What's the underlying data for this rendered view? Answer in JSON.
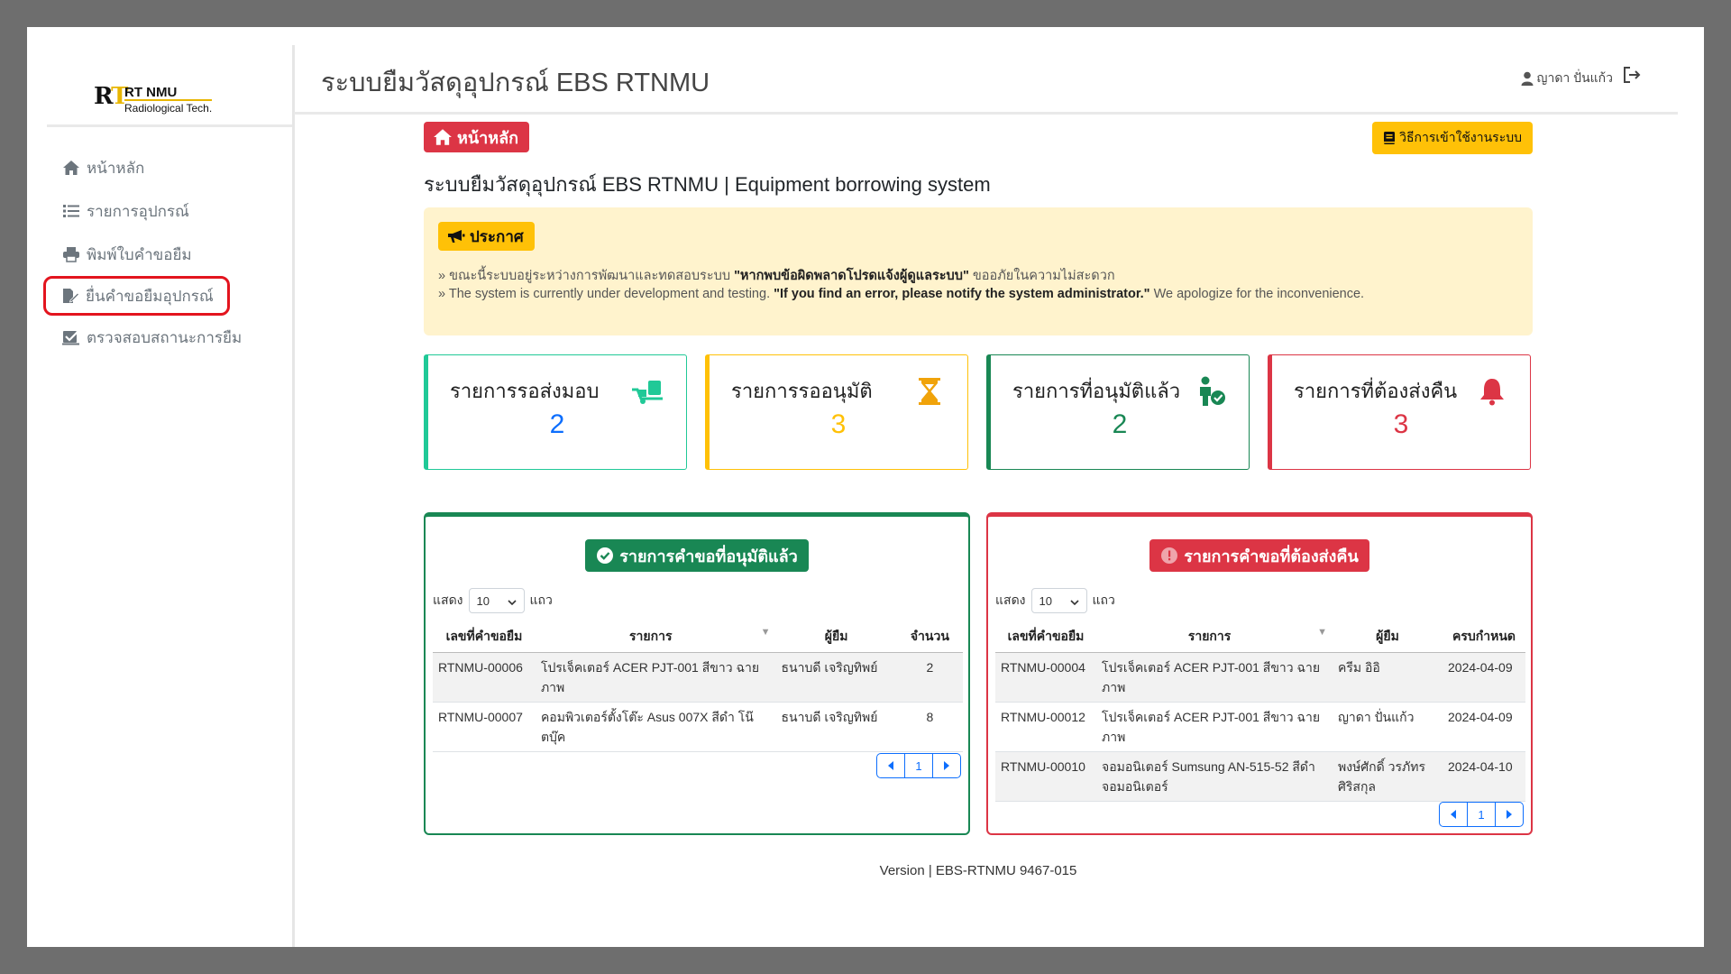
{
  "logo": {
    "mark": "RT",
    "title": "RT NMU",
    "subtitle": "Radiological Tech."
  },
  "sidebar": {
    "items": [
      {
        "label": "หน้าหลัก",
        "icon": "home-icon"
      },
      {
        "label": "รายการอุปกรณ์",
        "icon": "list-icon"
      },
      {
        "label": "พิมพ์ใบคำขอยืม",
        "icon": "printer-icon"
      },
      {
        "label": "ยื่นคำขอยืมอุปกรณ์",
        "icon": "file-edit-icon",
        "highlighted": true
      },
      {
        "label": "ตรวจสอบสถานะการยืม",
        "icon": "check-square-icon"
      }
    ]
  },
  "header": {
    "title": "ระบบยืมวัสดุอุปกรณ์ EBS RTNMU",
    "user_name": "ญาดา ปั่นแก้ว"
  },
  "main": {
    "badge": "หน้าหลัก",
    "guide_button": "วิธีการเข้าใช้งานระบบ",
    "subtitle": "ระบบยืมวัสดุอุปกรณ์ EBS RTNMU | Equipment borrowing system",
    "announcement": {
      "badge": "ประกาศ",
      "th_prefix": "ขณะนี้ระบบอยู่ระหว่างการพัฒนาและทดสอบระบบ ",
      "th_bold": "\"หากพบข้อผิดพลาดโปรดแจ้งผู้ดูแลระบบ\"",
      "th_suffix": " ขออภัยในความไม่สะดวก",
      "en_prefix": "The system is currently under development and testing. ",
      "en_bold": "\"If you find an error, please notify the system administrator.\"",
      "en_suffix": " We apologize for the inconvenience."
    },
    "stats": [
      {
        "label": "รายการรอส่งมอบ",
        "value": "2",
        "color": "#20c997",
        "num_color": "#0d6efd",
        "icon": "dolly-icon"
      },
      {
        "label": "รายการรออนุมัติ",
        "value": "3",
        "color": "#ffc107",
        "num_color": "#ffc107",
        "icon": "hourglass-icon"
      },
      {
        "label": "รายการที่อนุมัติแล้ว",
        "value": "2",
        "color": "#198754",
        "num_color": "#198754",
        "icon": "person-check-icon"
      },
      {
        "label": "รายการที่ต้องส่งคืน",
        "value": "3",
        "color": "#dc3545",
        "num_color": "#dc3545",
        "icon": "bell-icon"
      }
    ],
    "approved": {
      "title": "รายการคำขอที่อนุมัติแล้ว",
      "show_label": "แสดง",
      "page_size": "10",
      "rows_label": "แถว",
      "headers": [
        "เลขที่คำขอยืม",
        "รายการ",
        "ผู้ยืม",
        "จำนวน"
      ],
      "rows": [
        [
          "RTNMU-00006",
          "โปรเจ็คเตอร์ ACER PJT-001 สีขาว ฉายภาพ",
          "ธนาบดี เจริญทิพย์",
          "2"
        ],
        [
          "RTNMU-00007",
          "คอมพิวเตอร์ตั้งโต๊ะ Asus 007X สีดำ โน๊ตบุ๊ค",
          "ธนาบดี เจริญทิพย์",
          "8"
        ]
      ],
      "page": "1"
    },
    "returns": {
      "title": "รายการคำขอที่ต้องส่งคืน",
      "show_label": "แสดง",
      "page_size": "10",
      "rows_label": "แถว",
      "headers": [
        "เลขที่คำขอยืม",
        "รายการ",
        "ผู้ยืม",
        "ครบกำหนด"
      ],
      "rows": [
        [
          "RTNMU-00004",
          "โปรเจ็คเตอร์ ACER PJT-001 สีขาว ฉายภาพ",
          "ครีม อิอิ",
          "2024-04-09"
        ],
        [
          "RTNMU-00012",
          "โปรเจ็คเตอร์ ACER PJT-001 สีขาว ฉายภาพ",
          "ญาดา ปั่นแก้ว",
          "2024-04-09"
        ],
        [
          "RTNMU-00010",
          "จอมอนิเตอร์ Sumsung AN-515-52 สีดำ จอมอนิเตอร์",
          "พงษ์ศักดิ์ วรภัทร ศิริสกุล",
          "2024-04-10"
        ]
      ],
      "page": "1"
    },
    "version": "Version | EBS-RTNMU 9467-015"
  }
}
